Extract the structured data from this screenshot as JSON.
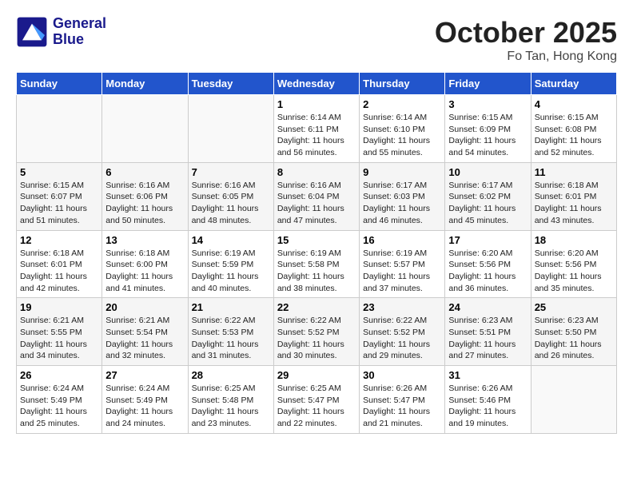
{
  "header": {
    "logo_line1": "General",
    "logo_line2": "Blue",
    "month": "October 2025",
    "location": "Fo Tan, Hong Kong"
  },
  "weekdays": [
    "Sunday",
    "Monday",
    "Tuesday",
    "Wednesday",
    "Thursday",
    "Friday",
    "Saturday"
  ],
  "weeks": [
    [
      {
        "day": "",
        "info": ""
      },
      {
        "day": "",
        "info": ""
      },
      {
        "day": "",
        "info": ""
      },
      {
        "day": "1",
        "info": "Sunrise: 6:14 AM\nSunset: 6:11 PM\nDaylight: 11 hours\nand 56 minutes."
      },
      {
        "day": "2",
        "info": "Sunrise: 6:14 AM\nSunset: 6:10 PM\nDaylight: 11 hours\nand 55 minutes."
      },
      {
        "day": "3",
        "info": "Sunrise: 6:15 AM\nSunset: 6:09 PM\nDaylight: 11 hours\nand 54 minutes."
      },
      {
        "day": "4",
        "info": "Sunrise: 6:15 AM\nSunset: 6:08 PM\nDaylight: 11 hours\nand 52 minutes."
      }
    ],
    [
      {
        "day": "5",
        "info": "Sunrise: 6:15 AM\nSunset: 6:07 PM\nDaylight: 11 hours\nand 51 minutes."
      },
      {
        "day": "6",
        "info": "Sunrise: 6:16 AM\nSunset: 6:06 PM\nDaylight: 11 hours\nand 50 minutes."
      },
      {
        "day": "7",
        "info": "Sunrise: 6:16 AM\nSunset: 6:05 PM\nDaylight: 11 hours\nand 48 minutes."
      },
      {
        "day": "8",
        "info": "Sunrise: 6:16 AM\nSunset: 6:04 PM\nDaylight: 11 hours\nand 47 minutes."
      },
      {
        "day": "9",
        "info": "Sunrise: 6:17 AM\nSunset: 6:03 PM\nDaylight: 11 hours\nand 46 minutes."
      },
      {
        "day": "10",
        "info": "Sunrise: 6:17 AM\nSunset: 6:02 PM\nDaylight: 11 hours\nand 45 minutes."
      },
      {
        "day": "11",
        "info": "Sunrise: 6:18 AM\nSunset: 6:01 PM\nDaylight: 11 hours\nand 43 minutes."
      }
    ],
    [
      {
        "day": "12",
        "info": "Sunrise: 6:18 AM\nSunset: 6:01 PM\nDaylight: 11 hours\nand 42 minutes."
      },
      {
        "day": "13",
        "info": "Sunrise: 6:18 AM\nSunset: 6:00 PM\nDaylight: 11 hours\nand 41 minutes."
      },
      {
        "day": "14",
        "info": "Sunrise: 6:19 AM\nSunset: 5:59 PM\nDaylight: 11 hours\nand 40 minutes."
      },
      {
        "day": "15",
        "info": "Sunrise: 6:19 AM\nSunset: 5:58 PM\nDaylight: 11 hours\nand 38 minutes."
      },
      {
        "day": "16",
        "info": "Sunrise: 6:19 AM\nSunset: 5:57 PM\nDaylight: 11 hours\nand 37 minutes."
      },
      {
        "day": "17",
        "info": "Sunrise: 6:20 AM\nSunset: 5:56 PM\nDaylight: 11 hours\nand 36 minutes."
      },
      {
        "day": "18",
        "info": "Sunrise: 6:20 AM\nSunset: 5:56 PM\nDaylight: 11 hours\nand 35 minutes."
      }
    ],
    [
      {
        "day": "19",
        "info": "Sunrise: 6:21 AM\nSunset: 5:55 PM\nDaylight: 11 hours\nand 34 minutes."
      },
      {
        "day": "20",
        "info": "Sunrise: 6:21 AM\nSunset: 5:54 PM\nDaylight: 11 hours\nand 32 minutes."
      },
      {
        "day": "21",
        "info": "Sunrise: 6:22 AM\nSunset: 5:53 PM\nDaylight: 11 hours\nand 31 minutes."
      },
      {
        "day": "22",
        "info": "Sunrise: 6:22 AM\nSunset: 5:52 PM\nDaylight: 11 hours\nand 30 minutes."
      },
      {
        "day": "23",
        "info": "Sunrise: 6:22 AM\nSunset: 5:52 PM\nDaylight: 11 hours\nand 29 minutes."
      },
      {
        "day": "24",
        "info": "Sunrise: 6:23 AM\nSunset: 5:51 PM\nDaylight: 11 hours\nand 27 minutes."
      },
      {
        "day": "25",
        "info": "Sunrise: 6:23 AM\nSunset: 5:50 PM\nDaylight: 11 hours\nand 26 minutes."
      }
    ],
    [
      {
        "day": "26",
        "info": "Sunrise: 6:24 AM\nSunset: 5:49 PM\nDaylight: 11 hours\nand 25 minutes."
      },
      {
        "day": "27",
        "info": "Sunrise: 6:24 AM\nSunset: 5:49 PM\nDaylight: 11 hours\nand 24 minutes."
      },
      {
        "day": "28",
        "info": "Sunrise: 6:25 AM\nSunset: 5:48 PM\nDaylight: 11 hours\nand 23 minutes."
      },
      {
        "day": "29",
        "info": "Sunrise: 6:25 AM\nSunset: 5:47 PM\nDaylight: 11 hours\nand 22 minutes."
      },
      {
        "day": "30",
        "info": "Sunrise: 6:26 AM\nSunset: 5:47 PM\nDaylight: 11 hours\nand 21 minutes."
      },
      {
        "day": "31",
        "info": "Sunrise: 6:26 AM\nSunset: 5:46 PM\nDaylight: 11 hours\nand 19 minutes."
      },
      {
        "day": "",
        "info": ""
      }
    ]
  ]
}
